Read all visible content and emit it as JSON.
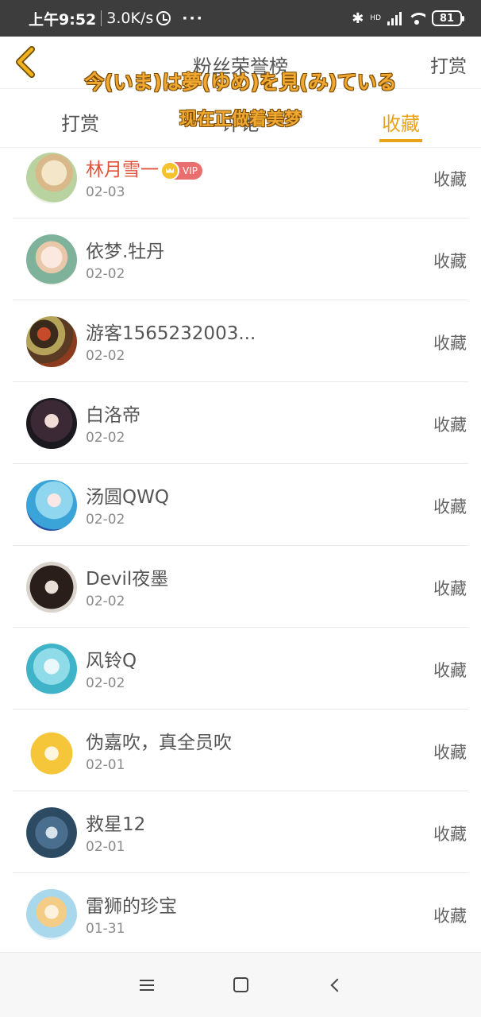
{
  "status_bar": {
    "time": "上午9:52",
    "speed": "3.0K/s",
    "dots": "···",
    "network_type": "HD",
    "battery": "81"
  },
  "header": {
    "title": "粉丝荣誉榜",
    "right_action": "打赏"
  },
  "overlay": {
    "line1": "今(いま)は夢(ゆめ)を見(み)ている",
    "line2": "现在正做着美梦"
  },
  "tabs": [
    {
      "label": "打赏",
      "active": false
    },
    {
      "label": "评论",
      "active": false
    },
    {
      "label": "收藏",
      "active": true
    }
  ],
  "vip_label": "VIP",
  "list": [
    {
      "name": "林月雪一",
      "date": "02-03",
      "action": "收藏",
      "vip": true
    },
    {
      "name": "依梦.牡丹",
      "date": "02-02",
      "action": "收藏"
    },
    {
      "name": "游客1565232003...",
      "date": "02-02",
      "action": "收藏"
    },
    {
      "name": "白洛帝",
      "date": "02-02",
      "action": "收藏"
    },
    {
      "name": "汤圆QWQ",
      "date": "02-02",
      "action": "收藏"
    },
    {
      "name": "Devil夜墨",
      "date": "02-02",
      "action": "收藏"
    },
    {
      "name": "风铃Q",
      "date": "02-02",
      "action": "收藏"
    },
    {
      "name": "伪嘉吹，真全员吹",
      "date": "02-01",
      "action": "收藏"
    },
    {
      "name": "救星12",
      "date": "02-01",
      "action": "收藏"
    },
    {
      "name": "雷狮的珍宝",
      "date": "01-31",
      "action": "收藏"
    }
  ],
  "colors": {
    "accent": "#e8a31a",
    "highlight_name": "#e0533c",
    "status_bar": "#3d3d3d"
  }
}
